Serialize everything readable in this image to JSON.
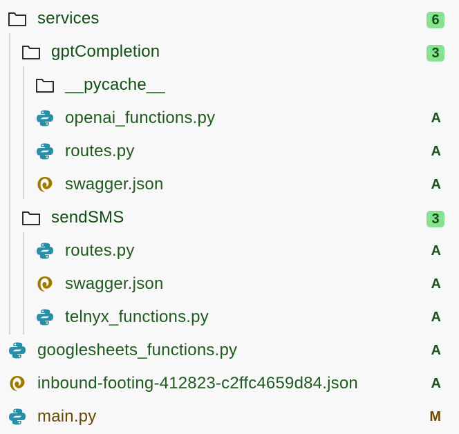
{
  "tree": {
    "services": {
      "name": "services",
      "count": "6",
      "icon": "folder-icon"
    },
    "gptCompletion": {
      "name": "gptCompletion",
      "count": "3",
      "icon": "folder-icon"
    },
    "pycache": {
      "name": "__pycache__",
      "icon": "folder-icon"
    },
    "openai_functions": {
      "name": "openai_functions.py",
      "status": "A",
      "icon": "python-icon"
    },
    "gpt_routes": {
      "name": "routes.py",
      "status": "A",
      "icon": "python-icon"
    },
    "gpt_swagger": {
      "name": "swagger.json",
      "status": "A",
      "icon": "json-icon"
    },
    "sendSMS": {
      "name": "sendSMS",
      "count": "3",
      "icon": "folder-icon"
    },
    "sms_routes": {
      "name": "routes.py",
      "status": "A",
      "icon": "python-icon"
    },
    "sms_swagger": {
      "name": "swagger.json",
      "status": "A",
      "icon": "json-icon"
    },
    "telnyx_functions": {
      "name": "telnyx_functions.py",
      "status": "A",
      "icon": "python-icon"
    },
    "googlesheets_functions": {
      "name": "googlesheets_functions.py",
      "status": "A",
      "icon": "python-icon"
    },
    "inbound_json": {
      "name": "inbound-footing-412823-c2ffc4659d84.json",
      "status": "A",
      "icon": "json-icon"
    },
    "main": {
      "name": "main.py",
      "status": "M",
      "icon": "python-icon"
    }
  },
  "colors": {
    "added": "#17531b",
    "modified": "#6a4a00",
    "badge_bg": "#86e28f",
    "python_blue": "#2a8fa6",
    "json_gold": "#9a7a00"
  }
}
